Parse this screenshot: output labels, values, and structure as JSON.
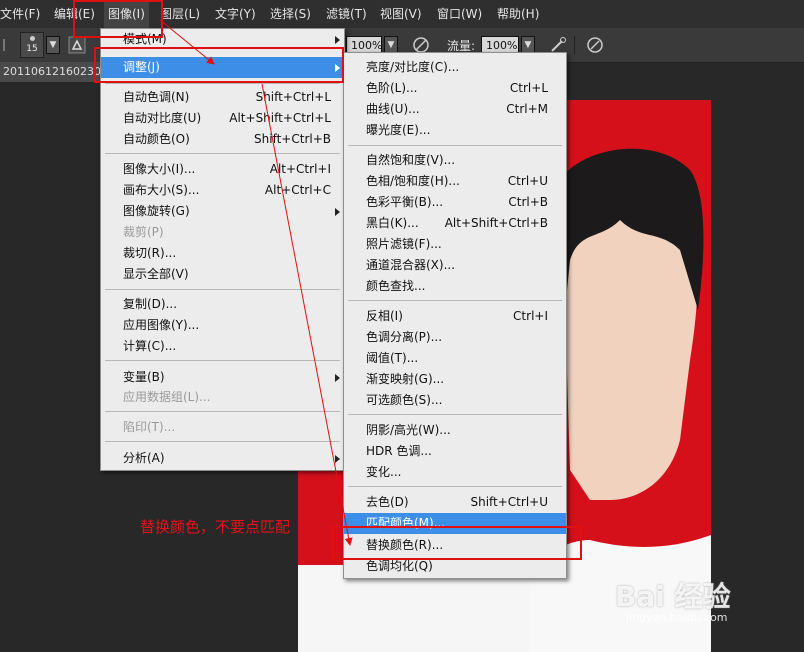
{
  "menubar": {
    "items": [
      "文件(F)",
      "编辑(E)",
      "图像(I)",
      "图层(L)",
      "文字(Y)",
      "选择(S)",
      "滤镜(T)",
      "视图(V)",
      "窗口(W)",
      "帮助(H)"
    ]
  },
  "optbar": {
    "brush_size": "15",
    "opacity_value": "100%",
    "flow_label": "流量:",
    "flow_value": "100%"
  },
  "document": {
    "tab_title": "20110612160230"
  },
  "image_menu": {
    "items": [
      {
        "label": "模式(M)",
        "shortcut": ""
      },
      {
        "label": "调整(J)",
        "shortcut": ""
      },
      {
        "label": "自动色调(N)",
        "shortcut": "Shift+Ctrl+L"
      },
      {
        "label": "自动对比度(U)",
        "shortcut": "Alt+Shift+Ctrl+L"
      },
      {
        "label": "自动颜色(O)",
        "shortcut": "Shift+Ctrl+B"
      },
      {
        "label": "图像大小(I)...",
        "shortcut": "Alt+Ctrl+I"
      },
      {
        "label": "画布大小(S)...",
        "shortcut": "Alt+Ctrl+C"
      },
      {
        "label": "图像旋转(G)",
        "shortcut": ""
      },
      {
        "label": "裁剪(P)",
        "shortcut": ""
      },
      {
        "label": "裁切(R)...",
        "shortcut": ""
      },
      {
        "label": "显示全部(V)",
        "shortcut": ""
      },
      {
        "label": "复制(D)...",
        "shortcut": ""
      },
      {
        "label": "应用图像(Y)...",
        "shortcut": ""
      },
      {
        "label": "计算(C)...",
        "shortcut": ""
      },
      {
        "label": "变量(B)",
        "shortcut": ""
      },
      {
        "label": "应用数据组(L)...",
        "shortcut": ""
      },
      {
        "label": "陷印(T)...",
        "shortcut": ""
      },
      {
        "label": "分析(A)",
        "shortcut": ""
      }
    ]
  },
  "adjust_menu": {
    "items": [
      {
        "label": "亮度/对比度(C)...",
        "shortcut": ""
      },
      {
        "label": "色阶(L)...",
        "shortcut": "Ctrl+L"
      },
      {
        "label": "曲线(U)...",
        "shortcut": "Ctrl+M"
      },
      {
        "label": "曝光度(E)...",
        "shortcut": ""
      },
      {
        "label": "自然饱和度(V)...",
        "shortcut": ""
      },
      {
        "label": "色相/饱和度(H)...",
        "shortcut": "Ctrl+U"
      },
      {
        "label": "色彩平衡(B)...",
        "shortcut": "Ctrl+B"
      },
      {
        "label": "黑白(K)...",
        "shortcut": "Alt+Shift+Ctrl+B"
      },
      {
        "label": "照片滤镜(F)...",
        "shortcut": ""
      },
      {
        "label": "通道混合器(X)...",
        "shortcut": ""
      },
      {
        "label": "颜色查找...",
        "shortcut": ""
      },
      {
        "label": "反相(I)",
        "shortcut": "Ctrl+I"
      },
      {
        "label": "色调分离(P)...",
        "shortcut": ""
      },
      {
        "label": "阈值(T)...",
        "shortcut": ""
      },
      {
        "label": "渐变映射(G)...",
        "shortcut": ""
      },
      {
        "label": "可选颜色(S)...",
        "shortcut": ""
      },
      {
        "label": "阴影/高光(W)...",
        "shortcut": ""
      },
      {
        "label": "HDR 色调...",
        "shortcut": ""
      },
      {
        "label": "变化...",
        "shortcut": ""
      },
      {
        "label": "去色(D)",
        "shortcut": "Shift+Ctrl+U"
      },
      {
        "label": "匹配颜色(M)...",
        "shortcut": ""
      },
      {
        "label": "替换颜色(R)...",
        "shortcut": ""
      },
      {
        "label": "色调均化(Q)",
        "shortcut": ""
      }
    ]
  },
  "annotation": {
    "text": "替换颜色，不要点匹配"
  },
  "watermark": {
    "text": "Bai 经验",
    "url": "jingyan.baidu.com"
  },
  "colors": {
    "menu_bg": "#ececec",
    "highlight": "#3d8ee6",
    "annotation_red": "#e01010",
    "photo_red": "#d5101b"
  }
}
